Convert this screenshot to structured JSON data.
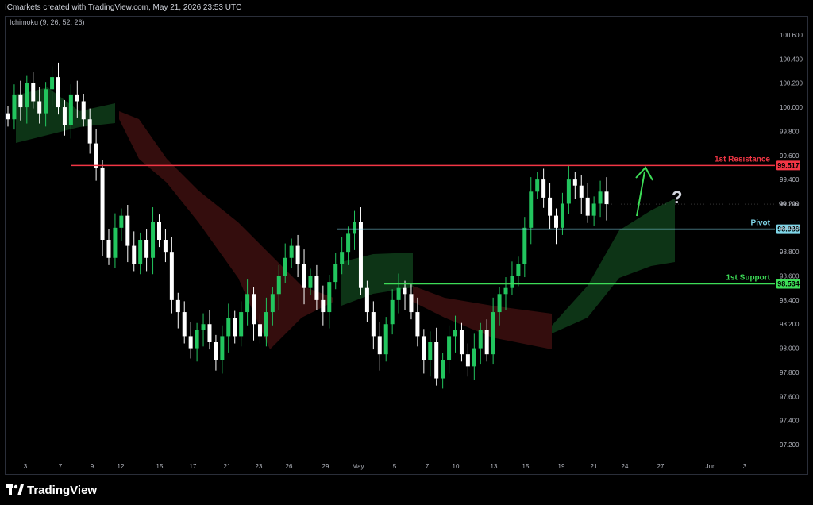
{
  "header": {
    "caption": "ICmarkets created with TradingView.com, May 21, 2026 23:53 UTC",
    "indicator": "Ichimoku (9, 26, 52, 26)"
  },
  "footer": {
    "brand": "TradingView"
  },
  "colors": {
    "background": "#000000",
    "candle_up": "#22c55e",
    "candle_down": "#ffffff",
    "cloud_bull": "#0f3d1a",
    "cloud_bear": "#3d0f0f",
    "resistance": "#f23645",
    "pivot": "#7fd6e8",
    "support": "#3ddc57",
    "arrow": "#3ddc57",
    "question": "#d1d4dc"
  },
  "chart_data": {
    "type": "candlestick",
    "title": "",
    "xlabel": "",
    "ylabel": "",
    "ylim": [
      97.1,
      100.75
    ],
    "y_ticks": [
      "100.600",
      "100.400",
      "100.200",
      "100.000",
      "99.800",
      "99.600",
      "99.400",
      "99.200",
      "99.000",
      "98.800",
      "98.600",
      "98.400",
      "98.200",
      "98.000",
      "97.800",
      "97.600",
      "97.400",
      "97.200"
    ],
    "x_ticks": [
      "3",
      "7",
      "9",
      "12",
      "15",
      "17",
      "21",
      "23",
      "26",
      "29",
      "May",
      "5",
      "7",
      "10",
      "13",
      "15",
      "19",
      "21",
      "24",
      "27",
      "Jun",
      "3"
    ],
    "current_price": "99.196",
    "levels": [
      {
        "name": "1st Resistance",
        "value": "99.517",
        "num": 99.517
      },
      {
        "name": "Pivot",
        "value": "98.988",
        "num": 98.988
      },
      {
        "name": "1st Support",
        "value": "98.534",
        "num": 98.534
      }
    ],
    "annotation": "?",
    "series_close": [
      99.9,
      100.1,
      100.0,
      100.2,
      100.05,
      99.95,
      100.15,
      100.25,
      100.0,
      99.85,
      100.1,
      100.05,
      99.9,
      99.7,
      99.5,
      98.9,
      98.75,
      99.0,
      99.1,
      98.85,
      98.7,
      98.9,
      98.75,
      99.05,
      98.9,
      98.8,
      98.4,
      98.3,
      98.1,
      98.0,
      98.15,
      98.2,
      98.05,
      97.9,
      98.1,
      98.25,
      98.1,
      98.3,
      98.45,
      98.2,
      98.1,
      98.3,
      98.45,
      98.6,
      98.75,
      98.85,
      98.7,
      98.5,
      98.6,
      98.4,
      98.3,
      98.55,
      98.7,
      98.8,
      98.95,
      99.05,
      98.5,
      98.3,
      98.1,
      97.95,
      98.2,
      98.4,
      98.5,
      98.45,
      98.3,
      98.1,
      97.9,
      98.05,
      97.75,
      97.9,
      98.1,
      98.15,
      97.95,
      97.85,
      98.0,
      98.15,
      97.95,
      98.3,
      98.45,
      98.5,
      98.6,
      98.7,
      99.0,
      99.3,
      99.4,
      99.25,
      99.1,
      99.0,
      99.2,
      99.4,
      99.35,
      99.25,
      99.1,
      99.2,
      99.3,
      99.196
    ]
  }
}
